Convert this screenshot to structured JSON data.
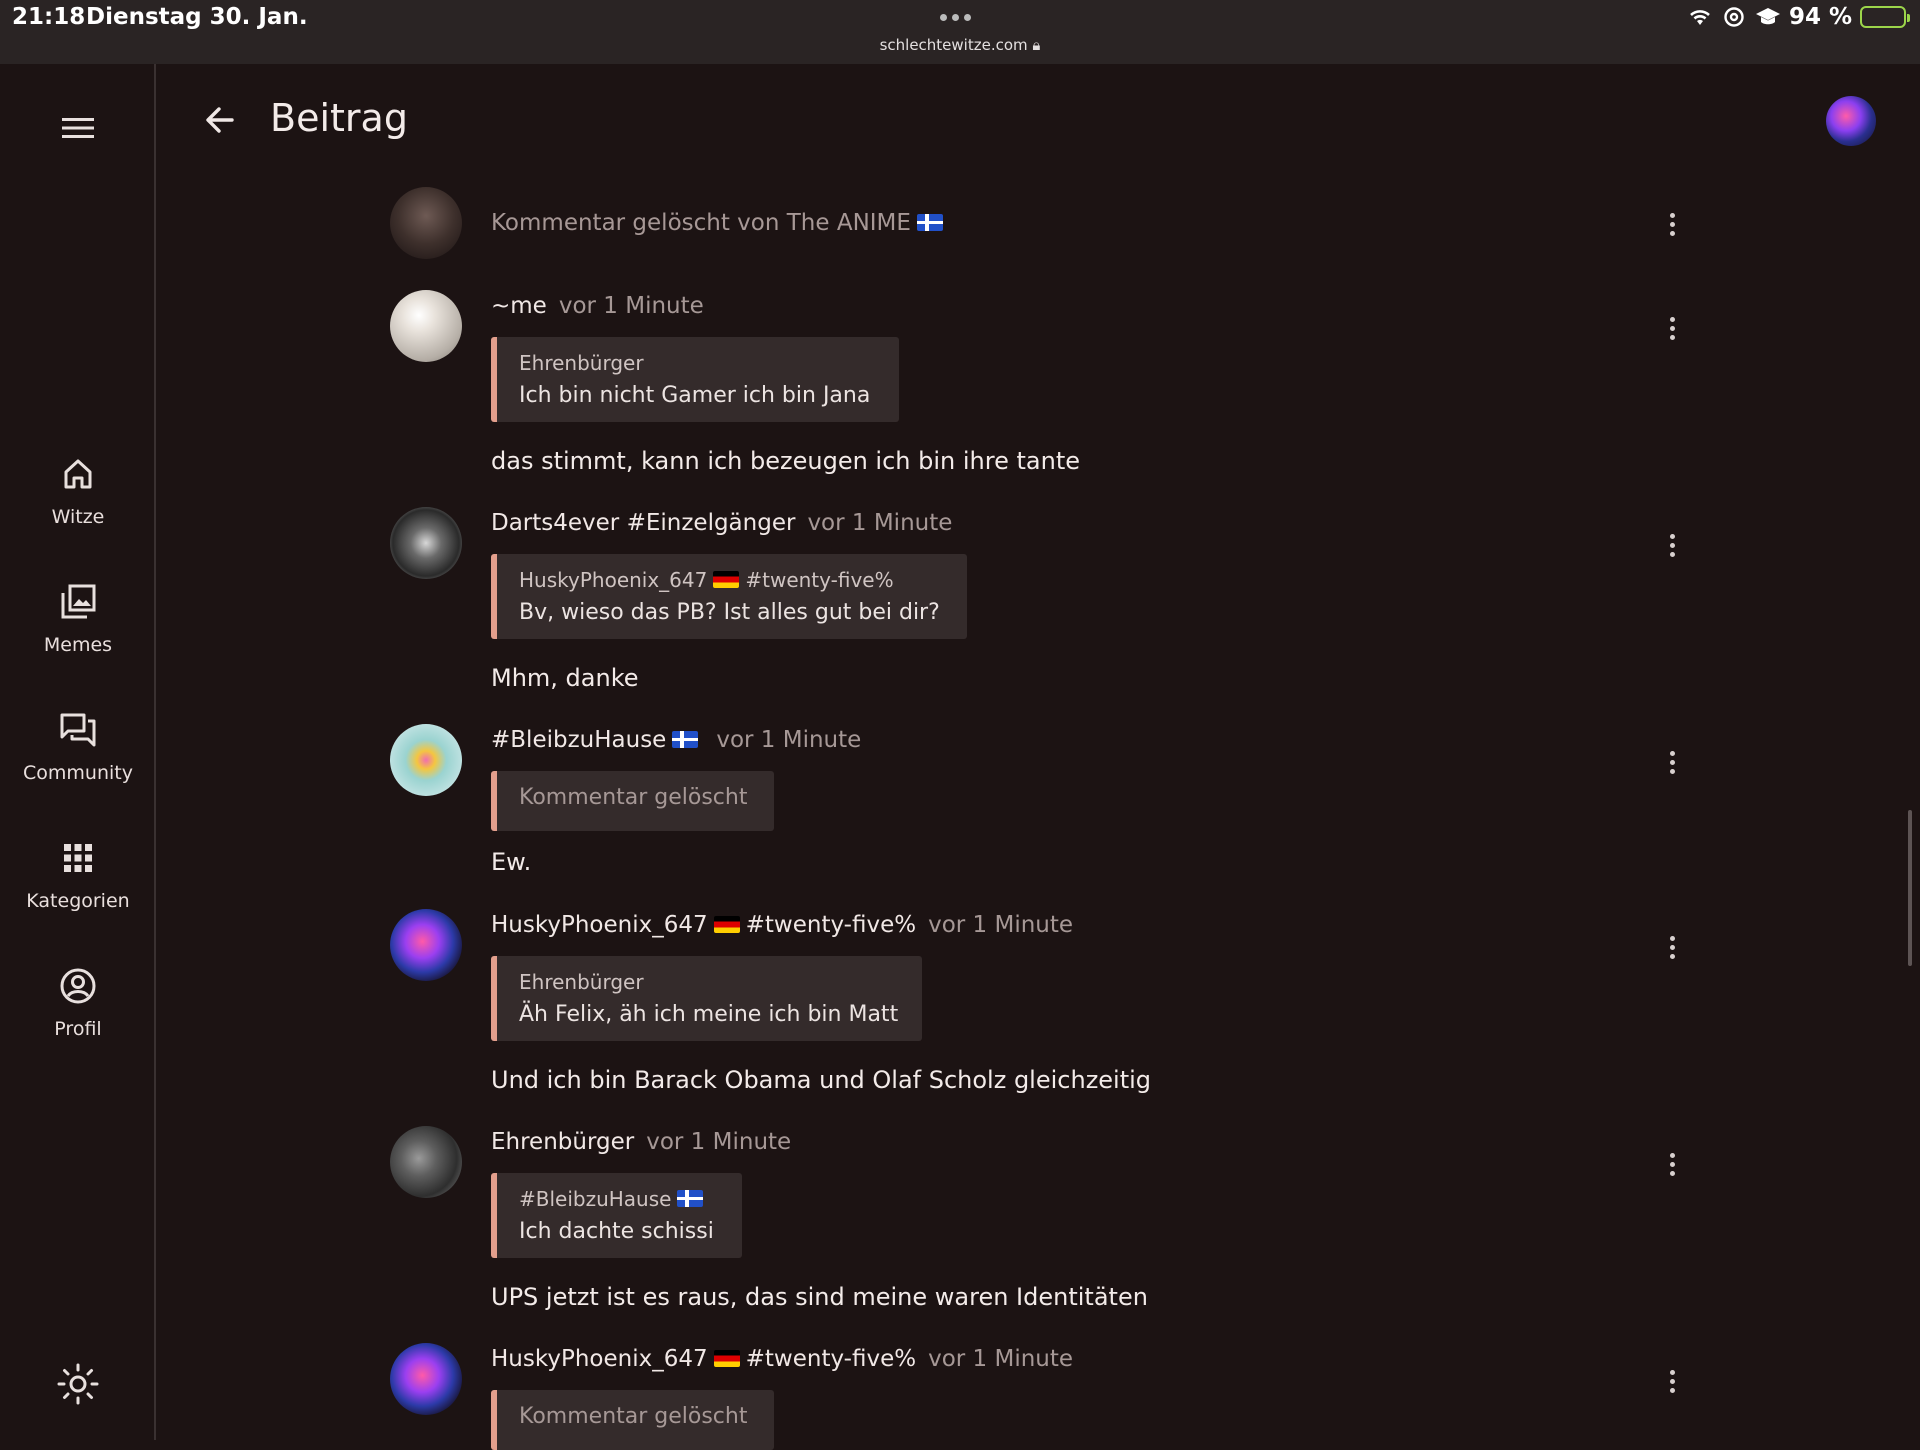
{
  "status_bar": {
    "time": "21:18",
    "date": "Dienstag 30. Jan.",
    "url": "schlechtewitze.com",
    "battery": "94 %",
    "icons": [
      "wifi-icon",
      "at-icon",
      "graduation-cap-icon",
      "battery-charging-icon"
    ]
  },
  "sidebar": {
    "items": [
      {
        "label": "Witze",
        "icon": "home-icon"
      },
      {
        "label": "Memes",
        "icon": "image-gallery-icon"
      },
      {
        "label": "Community",
        "icon": "chat-bubbles-icon"
      },
      {
        "label": "Kategorien",
        "icon": "grid-icon"
      },
      {
        "label": "Profil",
        "icon": "profile-icon"
      }
    ],
    "theme_icon": "sun-icon"
  },
  "header": {
    "title": "Beitrag",
    "back_icon": "arrow-left-icon"
  },
  "comments": [
    {
      "deleted_text": "Kommentar gelöscht von The ANIME"
    },
    {
      "author": "~me",
      "time": "vor 1 Minute",
      "quote_author": "Ehrenbürger",
      "quote_text": "Ich bin nicht Gamer ich bin Jana",
      "body": "das stimmt, kann ich bezeugen ich bin ihre tante"
    },
    {
      "author": "Darts4ever #Einzelgänger",
      "time": "vor 1 Minute",
      "quote_author": "HuskyPhoenix_647",
      "quote_author_tag": "#twenty-five%",
      "quote_text": "Bv, wieso das PB? Ist alles gut bei dir?",
      "body": "Mhm, danke"
    },
    {
      "author": "#BleibzuHause",
      "time": "vor 1 Minute",
      "quote_deleted": "Kommentar gelöscht",
      "body": "Ew."
    },
    {
      "author": "HuskyPhoenix_647",
      "author_tag": "#twenty-five%",
      "time": "vor 1 Minute",
      "quote_author": "Ehrenbürger",
      "quote_text": "Äh Felix, äh ich meine ich bin Matt",
      "body": "Und ich bin Barack Obama und Olaf Scholz gleichzeitig"
    },
    {
      "author": "Ehrenbürger",
      "time": "vor 1 Minute",
      "quote_author": "#BleibzuHause",
      "quote_text": "Ich dachte schissi",
      "body": "UPS jetzt ist es raus, das sind meine waren Identitäten"
    },
    {
      "author": "HuskyPhoenix_647",
      "author_tag": "#twenty-five%",
      "time": "vor 1 Minute",
      "quote_deleted": "Kommentar gelöscht"
    }
  ],
  "colors": {
    "background": "#1c1313",
    "accent": "#e39f8d",
    "quote_bg": "#342b2b"
  }
}
